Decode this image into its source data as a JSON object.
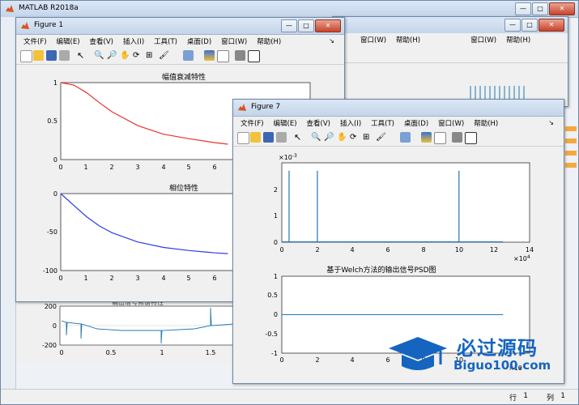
{
  "main_window": {
    "title": "MATLAB R2018a",
    "status_row_label": "行",
    "status_row_value": "1",
    "status_col_label": "列",
    "status_col_value": "1"
  },
  "figure1": {
    "title": "Figure 1",
    "menu": [
      "文件(F)",
      "编辑(E)",
      "查看(V)",
      "插入(I)",
      "工具(T)",
      "桌面(D)",
      "窗口(W)",
      "帮助(H)"
    ],
    "plot1_title": "幅值衰减特性",
    "plot2_title": "相位特性",
    "plot1_y_ticks": [
      "1",
      "0.5",
      "0"
    ],
    "plot1_x_ticks": [
      "0",
      "1",
      "2",
      "3",
      "4",
      "5",
      "6"
    ],
    "plot2_y_ticks": [
      "0",
      "-50",
      "-100"
    ],
    "plot2_x_ticks": [
      "0",
      "1",
      "2",
      "3",
      "4",
      "5",
      "6"
    ]
  },
  "figure7": {
    "title": "Figure 7",
    "menu": [
      "文件(F)",
      "编辑(E)",
      "查看(V)",
      "插入(I)",
      "工具(T)",
      "桌面(D)",
      "窗口(W)",
      "帮助(H)"
    ],
    "top_exp_label": "×10",
    "top_exp_power": "-3",
    "top_y_ticks": [
      "2",
      "1",
      "0"
    ],
    "top_x_ticks": [
      "0",
      "2",
      "4",
      "6",
      "8",
      "10",
      "12",
      "14"
    ],
    "top_x_exp_label": "×10",
    "top_x_exp_power": "4",
    "bottom_title": "基于Welch方法的输出信号PSD图",
    "bottom_y_ticks": [
      "1",
      "0.5",
      "0",
      "-0.5",
      "-1"
    ],
    "bottom_x_ticks": [
      "0",
      "2",
      "4",
      "6",
      "8",
      "10"
    ],
    "bottom_x_exp_label": "×10"
  },
  "back_window": {
    "menu_window": "窗口(W)",
    "menu_help": "帮助(H)"
  },
  "bottom_plot": {
    "title": "输出信号频谱特性",
    "y_ticks": [
      "200",
      "0",
      "-200"
    ],
    "x_ticks": [
      "0",
      "0.5",
      "1",
      "1.5"
    ]
  },
  "watermark": {
    "brand": "必过源码",
    "url": "Biguo100.com"
  },
  "colors": {
    "red_curve": "#e8322f",
    "blue_curve": "#2b3de0",
    "psd_line": "#1f77b4",
    "watermark": "#1565c0"
  },
  "chart_data": [
    {
      "type": "line",
      "title": "幅值衰减特性",
      "series": [
        {
          "x": [
            0,
            0.5,
            1,
            1.5,
            2,
            3,
            4,
            5,
            6,
            6.5
          ],
          "y": [
            1,
            0.97,
            0.87,
            0.74,
            0.62,
            0.44,
            0.33,
            0.27,
            0.22,
            0.2
          ]
        }
      ],
      "xlim": [
        0,
        7
      ],
      "ylim": [
        0,
        1
      ]
    },
    {
      "type": "line",
      "title": "相位特性",
      "series": [
        {
          "x": [
            0,
            0.5,
            1,
            1.5,
            2,
            3,
            4,
            5,
            6,
            6.5
          ],
          "y": [
            0,
            -15,
            -30,
            -42,
            -51,
            -63,
            -70,
            -74,
            -77,
            -78
          ]
        }
      ],
      "xlim": [
        0,
        7
      ],
      "ylim": [
        -100,
        0
      ]
    },
    {
      "type": "line",
      "title": "",
      "series": [
        {
          "x": [
            0,
            0.4,
            0.41,
            0.42,
            2,
            2.01,
            2.02,
            10,
            10.01,
            10.02,
            12.5
          ],
          "y": [
            0,
            0,
            2.7,
            0,
            0,
            2.7,
            0,
            0,
            2.7,
            0,
            0
          ]
        }
      ],
      "x_scale_note": "×10^4",
      "y_scale_note": "×10^-3",
      "xlim": [
        0,
        14
      ],
      "ylim": [
        0,
        3
      ]
    },
    {
      "type": "line",
      "title": "基于Welch方法的输出信号PSD图",
      "series": [
        {
          "x": [
            0,
            12.5
          ],
          "y": [
            0,
            0
          ]
        }
      ],
      "xlim": [
        0,
        14
      ],
      "ylim": [
        -1,
        1
      ]
    }
  ]
}
